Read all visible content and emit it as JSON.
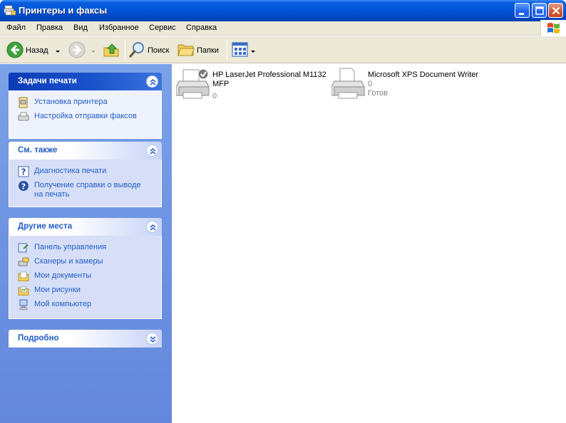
{
  "window": {
    "title": "Принтеры и факсы"
  },
  "menu": {
    "items": [
      "Файл",
      "Правка",
      "Вид",
      "Избранное",
      "Сервис",
      "Справка"
    ]
  },
  "toolbar": {
    "back_label": "Назад",
    "search_label": "Поиск",
    "folders_label": "Папки"
  },
  "sidebar": {
    "print_tasks": {
      "title": "Задачи печати",
      "items": [
        "Установка принтера",
        "Настройка отправки факсов"
      ]
    },
    "see_also": {
      "title": "См. также",
      "items": [
        "Диагностика печати",
        "Получение справки о выводе на печать"
      ]
    },
    "other_places": {
      "title": "Другие места",
      "items": [
        "Панель управления",
        "Сканеры и камеры",
        "Мои документы",
        "Мои рисунки",
        "Мой компьютер"
      ]
    },
    "details": {
      "title": "Подробно"
    }
  },
  "printers": [
    {
      "name": "HP LaserJet Professional M1132 MFP",
      "jobs": "0",
      "status": "",
      "is_default": true
    },
    {
      "name": "Microsoft XPS Document Writer",
      "jobs": "0",
      "status": "Готов",
      "is_default": false
    }
  ],
  "colors": {
    "titlebar": "#0053d6",
    "taskpane": "#6f96e2",
    "link": "#215dc6",
    "chrome": "#ece9d8"
  }
}
